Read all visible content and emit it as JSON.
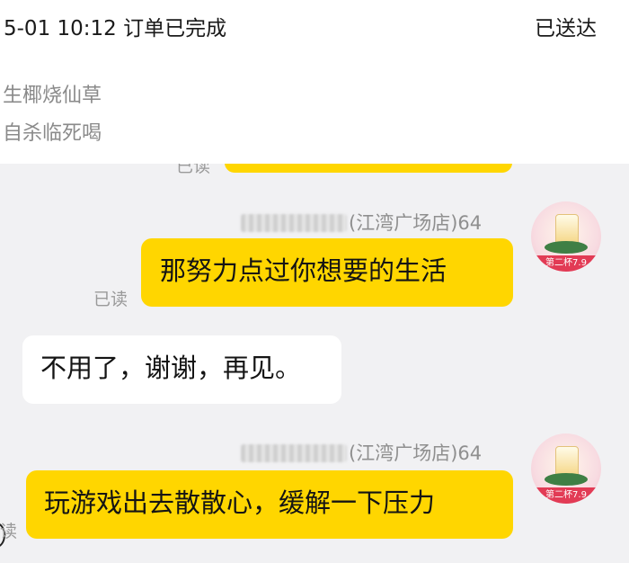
{
  "header": {
    "time_status": "5-01 10:12  订单已完成",
    "delivery_status": "已送达"
  },
  "summary": {
    "line1": "生椰烧仙草",
    "line2": "自杀临死喝"
  },
  "chat": {
    "read_label": "已读",
    "partial_read_label": "读",
    "store_suffix": "(江湾广场店)64",
    "avatar_tag": "第二杯7.9",
    "messages": [
      {
        "side": "right",
        "text": "那努力点过你想要的生活",
        "status": "已读"
      },
      {
        "side": "left",
        "text": "不用了，谢谢，再见。"
      },
      {
        "side": "right",
        "text": "玩游戏出去散散心，缓解一下压力",
        "status": "读"
      }
    ]
  }
}
